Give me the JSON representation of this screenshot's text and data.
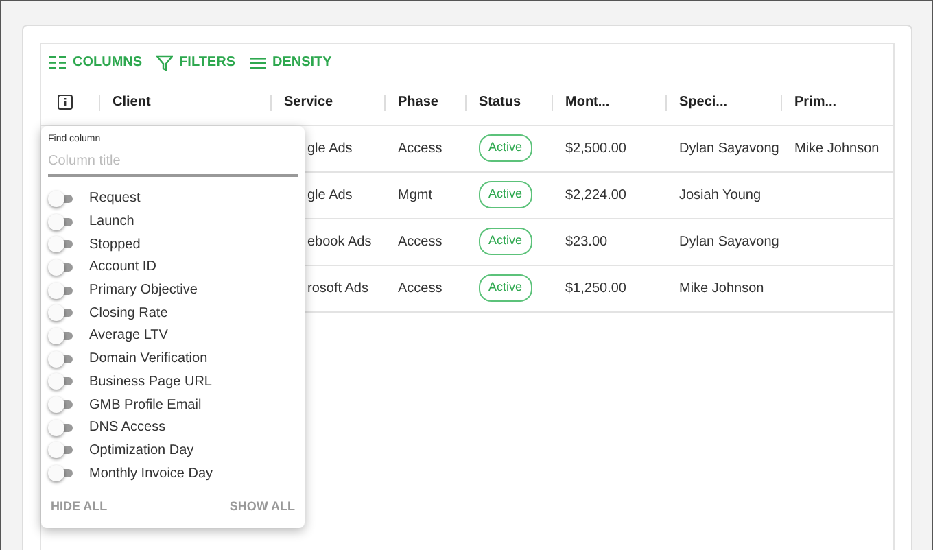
{
  "toolbar": [
    {
      "kind": "columns",
      "label": "COLUMNS"
    },
    {
      "kind": "filters",
      "label": "FILTERS"
    },
    {
      "kind": "density",
      "label": "DENSITY"
    }
  ],
  "table": {
    "columns": [
      "Client",
      "Service",
      "Phase",
      "Status",
      "Mont...",
      "Speci...",
      "Prim..."
    ],
    "rows": [
      {
        "service": "gle Ads",
        "phase": "Access",
        "status": "Active",
        "monthly": "$2,500.00",
        "specialist": "Dylan Sayavong",
        "primary": "Mike Johnson"
      },
      {
        "service": "gle Ads",
        "phase": "Mgmt",
        "status": "Active",
        "monthly": "$2,224.00",
        "specialist": "Josiah Young",
        "primary": ""
      },
      {
        "service": "ebook Ads",
        "phase": "Access",
        "status": "Active",
        "monthly": "$23.00",
        "specialist": "Dylan Sayavong",
        "primary": ""
      },
      {
        "service": "rosoft Ads",
        "phase": "Access",
        "status": "Active",
        "monthly": "$1,250.00",
        "specialist": "Mike Johnson",
        "primary": ""
      }
    ]
  },
  "column_panel": {
    "find_label": "Find column",
    "placeholder": "Column title",
    "items": [
      {
        "label": "Request",
        "on": false
      },
      {
        "label": "Launch",
        "on": false
      },
      {
        "label": "Stopped",
        "on": false
      },
      {
        "label": "Account ID",
        "on": false
      },
      {
        "label": "Primary Objective",
        "on": false
      },
      {
        "label": "Closing Rate",
        "on": false
      },
      {
        "label": "Average LTV",
        "on": false
      },
      {
        "label": "Domain Verification",
        "on": false
      },
      {
        "label": "Business Page URL",
        "on": false
      },
      {
        "label": "GMB Profile Email",
        "on": false
      },
      {
        "label": "DNS Access",
        "on": false
      },
      {
        "label": "Optimization Day",
        "on": false
      },
      {
        "label": "Monthly Invoice Day",
        "on": false
      }
    ],
    "buttons": [
      "HIDE ALL",
      "SHOW ALL"
    ]
  }
}
